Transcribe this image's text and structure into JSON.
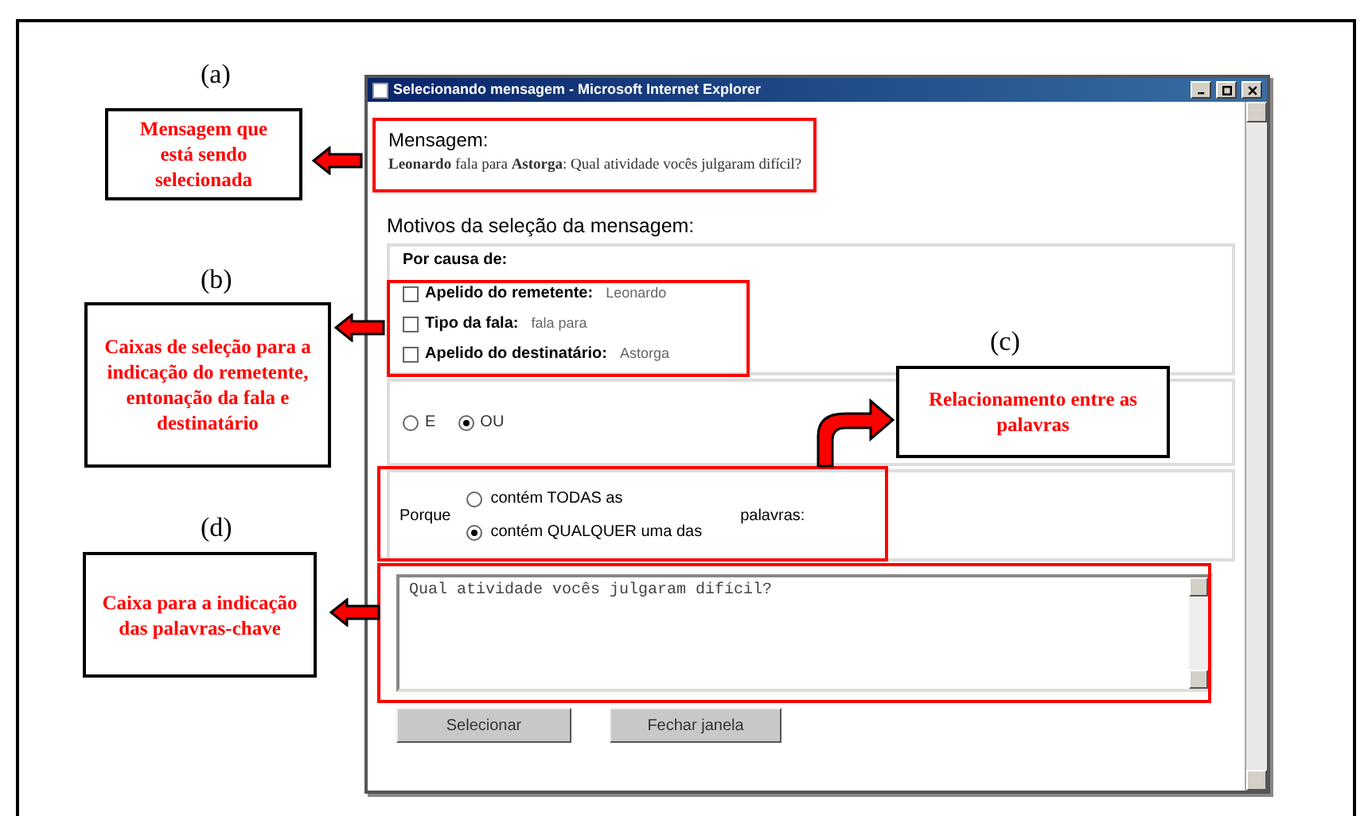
{
  "callouts": [
    {
      "label": "(a)",
      "text": "Mensagem que está sendo selecionada"
    },
    {
      "label": "(b)",
      "text": "Caixas de seleção para a indicação do remetente, entonação da fala e destinatário"
    },
    {
      "label": "(c)",
      "text": "Relacionamento entre as palavras"
    },
    {
      "label": "(d)",
      "text": "Caixa para a indicação das palavras-chave"
    }
  ],
  "window": {
    "title": "Selecionando mensagem - Microsoft Internet Explorer",
    "message": {
      "heading": "Mensagem:",
      "text": "**Leonardo** fala para **Astorga**: Qual atividade vocês julgaram difícil?"
    },
    "reasons_heading": "Motivos da seleção da mensagem:",
    "by_cause": {
      "heading": "Por causa de:",
      "checkboxes": [
        {
          "label": "Apelido do remetente:",
          "value": "Leonardo",
          "checked": false
        },
        {
          "label": "Tipo da fala:",
          "value": "fala para",
          "checked": false
        },
        {
          "label": "Apelido do destinatário:",
          "value": "Astorga",
          "checked": false
        }
      ]
    },
    "operator": [
      {
        "label": "E",
        "selected": false
      },
      {
        "label": "OU",
        "selected": true
      }
    ],
    "match": {
      "prefix": "Porque",
      "options": [
        {
          "label": "contém TODAS as",
          "selected": false
        },
        {
          "label": "contém QUALQUER uma das",
          "selected": true
        }
      ],
      "suffix": "palavras:"
    },
    "keywords": {
      "value": "Qual atividade vocês julgaram difícil?"
    },
    "buttons": [
      "Selecionar",
      "Fechar janela"
    ]
  }
}
